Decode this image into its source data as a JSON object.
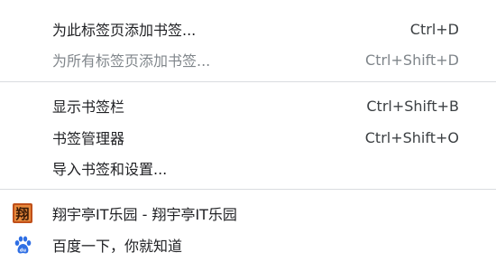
{
  "menu": {
    "items": [
      {
        "label": "为此标签页添加书签...",
        "shortcut": "Ctrl+D"
      },
      {
        "label": "为所有标签页添加书签...",
        "shortcut": "Ctrl+Shift+D"
      },
      {
        "label": "显示书签栏",
        "shortcut": "Ctrl+Shift+B"
      },
      {
        "label": "书签管理器",
        "shortcut": "Ctrl+Shift+O"
      },
      {
        "label": "导入书签和设置..."
      }
    ],
    "bookmarks": [
      {
        "label": "翔宇亭IT乐园 - 翔宇亭IT乐园",
        "icon": "xiangyu-favicon-icon",
        "icon_glyph": "翔",
        "icon_color": "#c0501a"
      },
      {
        "label": "百度一下，你就知道",
        "icon": "baidu-paw-icon",
        "icon_color": "#2f6fe4"
      }
    ]
  }
}
